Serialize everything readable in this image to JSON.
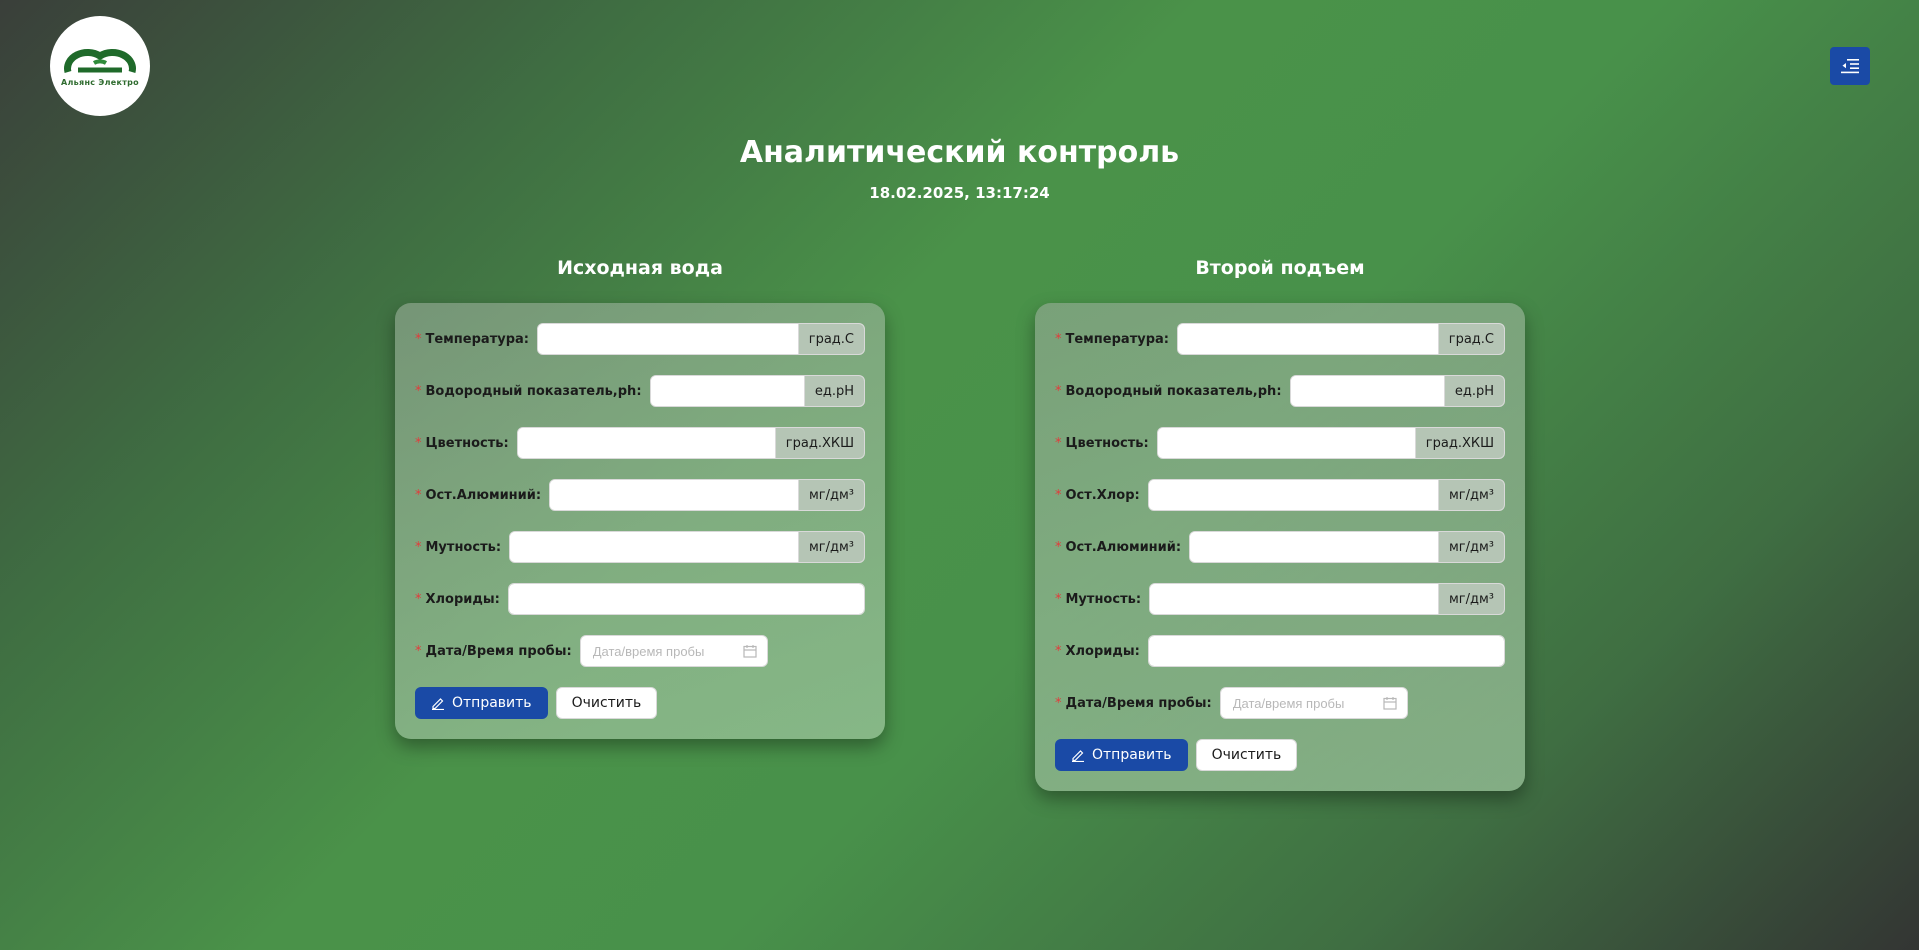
{
  "logo": {
    "text": "Альянс Электро"
  },
  "header": {
    "title": "Аналитический контроль",
    "datetime": "18.02.2025, 13:17:24"
  },
  "left": {
    "title": "Исходная вода",
    "fields": [
      {
        "label": "Температура",
        "unit": "град.С"
      },
      {
        "label": "Водородный показатель,ph",
        "unit": "ед.pH"
      },
      {
        "label": "Цветность",
        "unit": "град.ХКШ"
      },
      {
        "label": "Ост.Алюминий",
        "unit": "мг/дм³"
      },
      {
        "label": "Мутность",
        "unit": "мг/дм³"
      },
      {
        "label": "Хлориды"
      }
    ],
    "date_label": "Дата/Время пробы",
    "date_placeholder": "Дата/время пробы",
    "submit": "Отправить",
    "clear": "Очистить"
  },
  "right": {
    "title": "Второй подъем",
    "fields": [
      {
        "label": "Температура",
        "unit": "град.С"
      },
      {
        "label": "Водородный показатель,ph",
        "unit": "ед.pH"
      },
      {
        "label": "Цветность",
        "unit": "град.ХКШ"
      },
      {
        "label": "Ост.Хлор",
        "unit": "мг/дм³"
      },
      {
        "label": "Ост.Алюминий",
        "unit": "мг/дм³"
      },
      {
        "label": "Мутность",
        "unit": "мг/дм³"
      },
      {
        "label": "Хлориды"
      }
    ],
    "date_label": "Дата/Время пробы",
    "date_placeholder": "Дата/время пробы",
    "submit": "Отправить",
    "clear": "Очистить"
  },
  "colors": {
    "primary_button": "#1a4aa6",
    "required_mark": "#e23b3b",
    "background_green": "#4a9249"
  },
  "icons": {
    "menu": "menu-fold-icon",
    "submit": "edit-icon",
    "date": "calendar-icon"
  }
}
